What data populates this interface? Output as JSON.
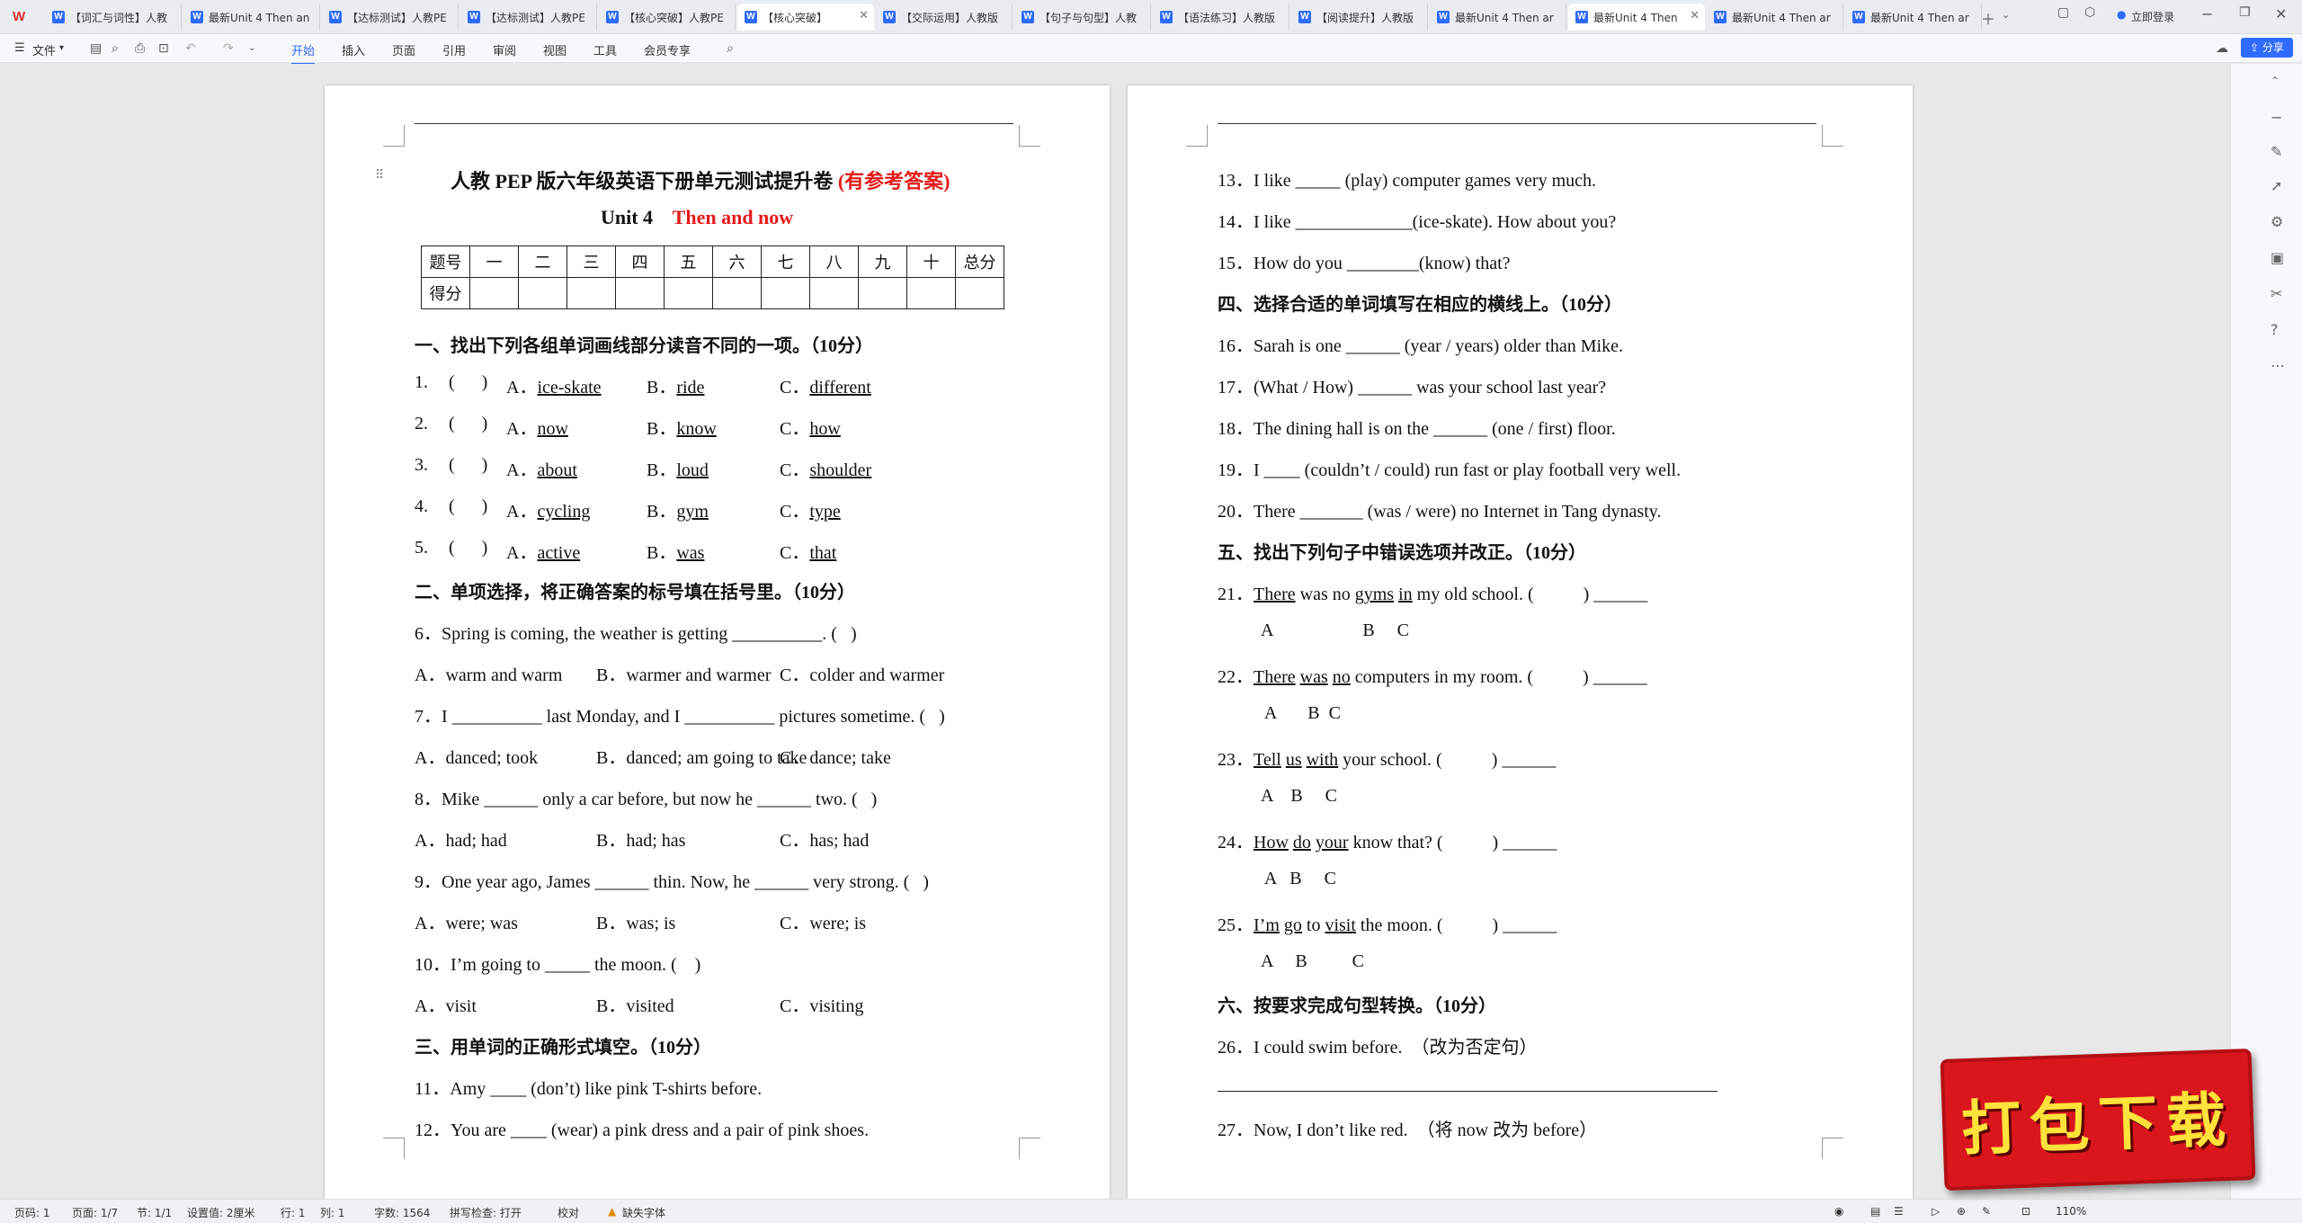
{
  "tabs": [
    {
      "label": "【词汇与词性】人教"
    },
    {
      "label": "最新Unit 4 Then an"
    },
    {
      "label": "【达标测试】人教PE"
    },
    {
      "label": "【达标测试】人教PE"
    },
    {
      "label": "【核心突破】人教PE"
    },
    {
      "label": "【核心突破】"
    },
    {
      "label": "【交际运用】人教版"
    },
    {
      "label": "【句子与句型】人教"
    },
    {
      "label": "【语法练习】人教版"
    },
    {
      "label": "【阅读提升】人教版"
    },
    {
      "label": "最新Unit 4  Then ar"
    },
    {
      "label": "最新Unit 4 Then"
    },
    {
      "label": "最新Unit 4 Then ar"
    },
    {
      "label": "最新Unit 4 Then ar"
    }
  ],
  "login_label": "立即登录",
  "menu": {
    "file": "文件",
    "start": "开始",
    "insert": "插入",
    "page": "页面",
    "ref": "引用",
    "review": "审阅",
    "view": "视图",
    "tools": "工具",
    "member": "会员专享",
    "share": "分享"
  },
  "doc": {
    "title_main": "人教 PEP 版六年级英语下册单元测试提升卷",
    "title_note": "(有参考答案)",
    "unit": "Unit 4",
    "unit_title": "Then and now",
    "table_head": [
      "题号",
      "一",
      "二",
      "三",
      "四",
      "五",
      "六",
      "七",
      "八",
      "九",
      "十",
      "总分"
    ],
    "table_score": "得分",
    "s1": "一、找出下列各组单词画线部分读音不同的一项。（10分）",
    "s1_items": [
      {
        "n": "1.",
        "a": "ice-skate",
        "b": "ride",
        "c": "different"
      },
      {
        "n": "2.",
        "a": "now",
        "b": "know",
        "c": "how"
      },
      {
        "n": "3.",
        "a": "about",
        "b": "loud",
        "c": "shoulder"
      },
      {
        "n": "4.",
        "a": "cycling",
        "b": "gym",
        "c": "type"
      },
      {
        "n": "5.",
        "a": "active",
        "b": "was",
        "c": "that"
      }
    ],
    "bracket": "(      )",
    "s2": "二、单项选择，将正确答案的标号填在括号里。（10分）",
    "q6": "6．Spring is coming, the weather is getting __________. (   )",
    "q6o": [
      "A．warm and warm",
      "B．warmer and warmer",
      "C．colder and warmer"
    ],
    "q7": "7．I __________ last Monday, and I __________ pictures sometime. (   )",
    "q7o": [
      "A．danced; took",
      "B．danced; am going to take",
      "C．dance; take"
    ],
    "q8": "8．Mike ______ only a car before, but now he ______ two. (   )",
    "q8o": [
      "A．had; had",
      "B．had; has",
      "C．has; had"
    ],
    "q9": "9．One year ago, James ______ thin. Now, he ______ very strong. (   )",
    "q9o": [
      "A．were; was",
      "B．was; is",
      "C．were; is"
    ],
    "q10": "10．I’m going to _____ the moon. (    )",
    "q10o": [
      "A．visit",
      "B．visited",
      "C．visiting"
    ],
    "s3": "三、用单词的正确形式填空。（10分）",
    "q11": "11．Amy ____ (don’t) like pink T-shirts before.",
    "q12": "12．You are ____ (wear) a pink dress and a pair of pink shoes.",
    "q13": "13．I like _____ (play) computer games very much.",
    "q14": "14．I like _____________(ice-skate). How about you?",
    "q15": "15．How do you ________(know) that?",
    "s4": "四、选择合适的单词填写在相应的横线上。（10分）",
    "q16": "16．Sarah is one ______ (year / years) older than Mike.",
    "q17": "17．(What / How) ______ was your school last year?",
    "q18": "18．The dining hall is on the ______ (one / first) floor.",
    "q19": "19．I ____ (couldn’t / could) run fast or play football very well.",
    "q20": "20．There _______ (was / were) no Internet in Tang dynasty.",
    "s5": "五、找出下列句子中错误选项并改正。（10分）",
    "q21": {
      "n": "21．",
      "w1": "There",
      "t1": " was no ",
      "w2": "gyms",
      "t2": " ",
      "w3": "in",
      "t3": " my old school. (           ) ______",
      "abc": "A                    B     C"
    },
    "q22": {
      "n": "22．",
      "w1": "There",
      "t1": " ",
      "w2": "was",
      "t2": " ",
      "w3": "no",
      "t3": " computers in my room. (           ) ______",
      "abc": " A       B  C"
    },
    "q23": {
      "n": "23．",
      "w1": "Tell",
      "t1": " ",
      "w2": "us",
      "t2": " ",
      "w3": "with",
      "t3": " your school. (           ) ______",
      "abc": "A    B     C"
    },
    "q24": {
      "n": "24．",
      "w1": "How",
      "t1": " ",
      "w2": "do",
      "t2": " ",
      "w3": "your",
      "t3": " know that? (           ) ______",
      "abc": " A   B     C"
    },
    "q25": {
      "n": "25．",
      "w1": "I’m",
      "t1": " ",
      "w2": "go",
      "t2": " to ",
      "w3": "visit",
      "t3": " the moon. (           ) ______",
      "abc": "A     B          C"
    },
    "s6": "六、按要求完成句型转换。（10分）",
    "q26": "26．I could swim before.  （改为否定句）",
    "q27": "27．Now, I don’t like red.  （将 now 改为 before）"
  },
  "status": {
    "page": "页码: 1",
    "pages": "页面: 1/7",
    "section": "节: 1/1",
    "setting": "设置值: 2厘米",
    "row": "行: 1",
    "col": "列: 1",
    "words": "字数: 1564",
    "spell": "拼写检查: 打开",
    "proof": "校对",
    "font": "缺失字体",
    "zoom": "110%"
  },
  "banner": "打包下载"
}
